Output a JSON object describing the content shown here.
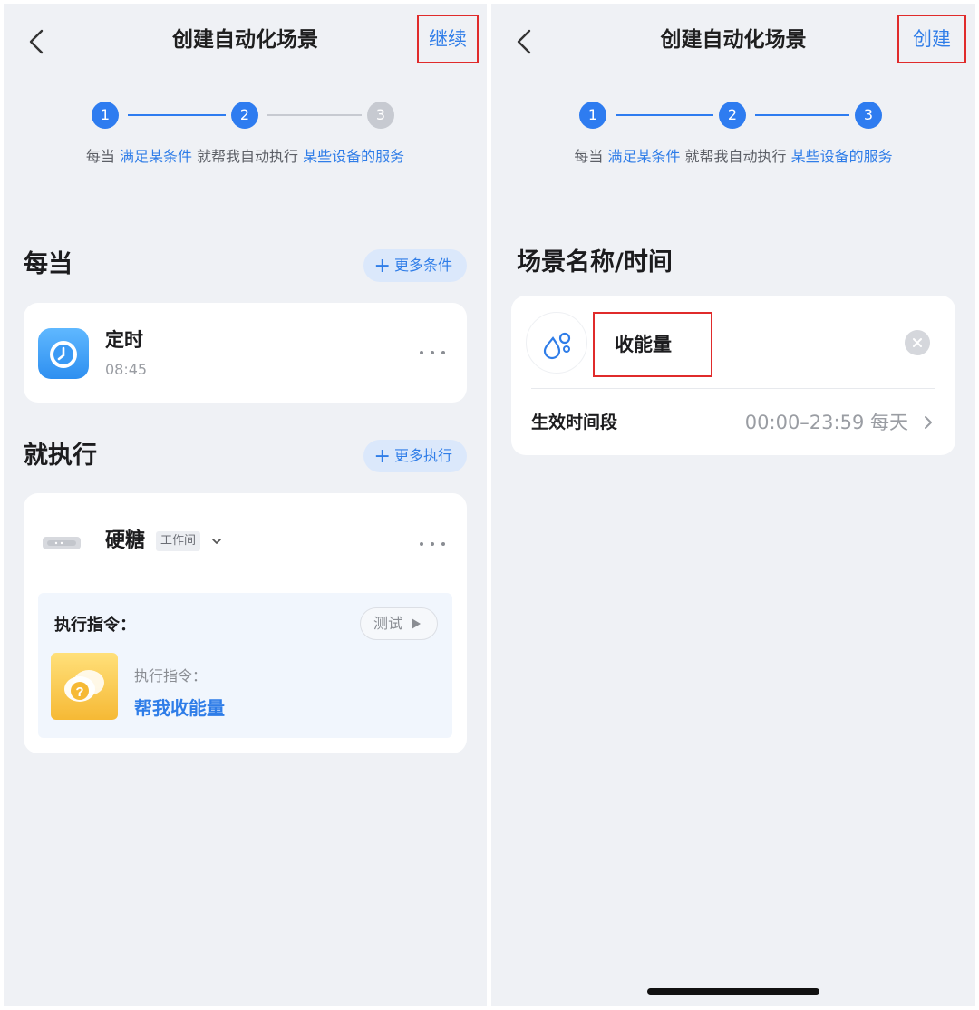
{
  "left_screen": {
    "header": {
      "title": "创建自动化场景",
      "action_label": "继续"
    },
    "steps": [
      {
        "label": "1",
        "state": "active"
      },
      {
        "label": "2",
        "state": "active"
      },
      {
        "label": "3",
        "state": "inactive"
      }
    ],
    "subtitle": {
      "part1": "每当 ",
      "hl1": "满足某条件",
      "part2": " 就帮我自动执行 ",
      "hl2": "某些设备的服务"
    },
    "when_section": {
      "title": "每当",
      "add_button": "更多条件",
      "trigger": {
        "title": "定时",
        "time": "08:45",
        "icon": "alarm-clock-icon"
      }
    },
    "then_section": {
      "title": "就执行",
      "add_button": "更多执行",
      "device": {
        "name": "硬糖",
        "room": "工作间",
        "icon": "speaker-device-icon",
        "command_label": "执行指令：",
        "test_label": "测试",
        "command_sub": "执行指令：",
        "command_value": "帮我收能量",
        "command_icon": "question-bubble-icon"
      }
    }
  },
  "right_screen": {
    "header": {
      "title": "创建自动化场景",
      "action_label": "创建"
    },
    "steps": [
      {
        "label": "1",
        "state": "active"
      },
      {
        "label": "2",
        "state": "active"
      },
      {
        "label": "3",
        "state": "active"
      }
    ],
    "subtitle": {
      "part1": "每当 ",
      "hl1": "满足某条件",
      "part2": " 就帮我自动执行 ",
      "hl2": "某些设备的服务"
    },
    "section_title": "场景名称/时间",
    "scene": {
      "name": "收能量",
      "icon": "water-drops-icon",
      "time_label": "生效时间段",
      "time_value": "00:00–23:59 每天"
    }
  },
  "colors": {
    "accent": "#2e7cf0",
    "link": "#2f7de8",
    "highlight_box": "#e02b2b",
    "background": "#eff1f5",
    "inactive_step": "#c7cad1"
  }
}
